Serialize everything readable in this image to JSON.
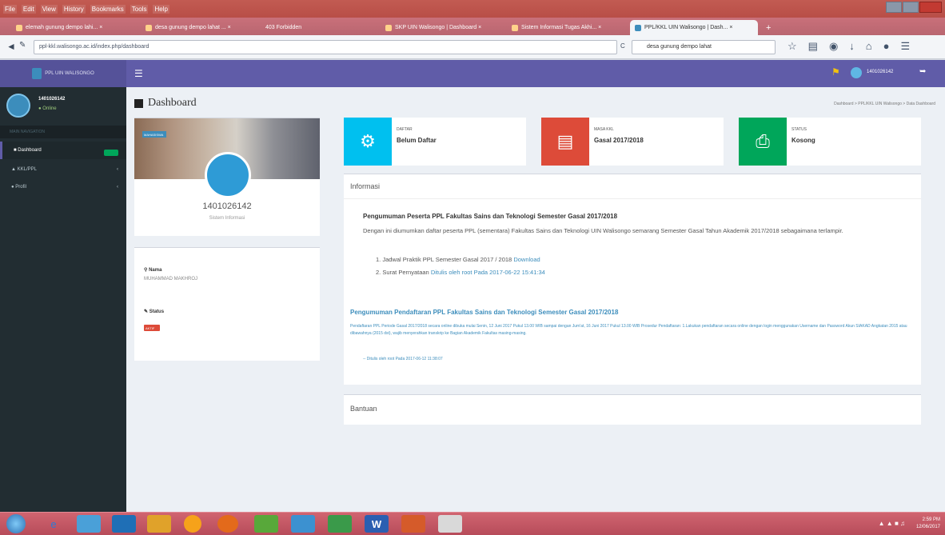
{
  "browser": {
    "menu": [
      "File",
      "Edit",
      "View",
      "History",
      "Bookmarks",
      "Tools",
      "Help"
    ],
    "tabs": [
      {
        "label": "elemah gunung dempo lahi... ×",
        "active": false
      },
      {
        "label": "desa gunung dempo lahat ... ×",
        "active": false
      },
      {
        "label": "403 Forbidden",
        "active": false
      },
      {
        "label": "SKP UIN Walisongo | Dashboard ×",
        "active": false
      },
      {
        "label": "Sistem Informasi Tugas Akhi... ×",
        "active": false
      },
      {
        "label": "PPL/KKL UIN Walisongo | Dash... ×",
        "active": true
      }
    ],
    "url": "ppl-kkl.walisongo.ac.id/index.php/dashboard",
    "search_value": "desa gunung dempo lahat",
    "reload_label": "C"
  },
  "topbar": {
    "logo_text": "PPL UIN WALISONGO",
    "user_name": "1401026142"
  },
  "sidebar": {
    "user_name": "1401026142",
    "status": "Online",
    "section_header": "MAIN NAVIGATION",
    "items": [
      {
        "label": "Dashboard",
        "active": true,
        "badge": "New"
      },
      {
        "label": "KKL/PPL",
        "active": false
      },
      {
        "label": "Profil",
        "active": false
      }
    ]
  },
  "page": {
    "title": "Dashboard",
    "breadcrumb": "Dashboard > PPL/KKL UIN Walisongo > Data Dashboard"
  },
  "profile": {
    "cover_label": "MAHASISWA",
    "number": "1401026142",
    "subtitle": "Sistem Informasi"
  },
  "details": {
    "name_label": "Nama",
    "name_value": "MUHAMMAD MAKHROJ",
    "status_label": "Status",
    "status_badge": "AKTIF"
  },
  "cards": [
    {
      "label": "DAFTAR",
      "value": "Belum Daftar",
      "color": "#00c0ef",
      "icon": "gear-icon"
    },
    {
      "label": "MASA KKL",
      "value": "Gasal 2017/2018",
      "color": "#dd4b39",
      "icon": "briefcase-icon"
    },
    {
      "label": "STATUS",
      "value": "Kosong",
      "color": "#00a65a",
      "icon": "printer-icon"
    }
  ],
  "informasi": {
    "title": "Informasi",
    "ann1_title": "Pengumuman Peserta PPL Fakultas Sains dan Teknologi Semester Gasal 2017/2018",
    "ann1_body": "Dengan ini diumumkan daftar peserta PPL (sementara) Fakultas Sains dan Teknologi UIN Walisongo semarang Semester Gasal Tahun Akademik 2017/2018 sebagaimana terlampir.",
    "list1_text": "1. Jadwal Praktik PPL Semester Gasal 2017 / 2018",
    "list1_link": "Download",
    "list2_text": "2. Surat Pernyataan",
    "list2_link": "Ditulis oleh root Pada 2017-06-22 15:41:34",
    "ann2_title": "Pengumuman Pendaftaran PPL Fakultas Sains dan Teknologi Semester Gasal 2017/2018",
    "ann2_body": "Pendaftaran PPL Periode Gasal 2017/2018 secara online dibuka mulai Senin, 12 Juni 2017 Pukul 13.00 WIB sampai dengan Jum'at, 16 Juni 2017 Pukul 13.00 WIB Prosedur Pendaftaran: 1.Lakukan pendaftaran secara online dengan login menggunakan Username dan Password Akun SIAKAD Angkatan 2015 atau dibawahnya (2015 dst), wajib menyerahkan transkrip ke Bagian Akademik Fakultas masing-masing.",
    "ann2_foot": "-- Ditulis oleh root Pada 2017-06-12 11:38:07"
  },
  "bantuan": {
    "title": "Bantuan"
  },
  "taskbar": {
    "clock_time": "2:59 PM",
    "clock_date": "12/06/2017"
  }
}
